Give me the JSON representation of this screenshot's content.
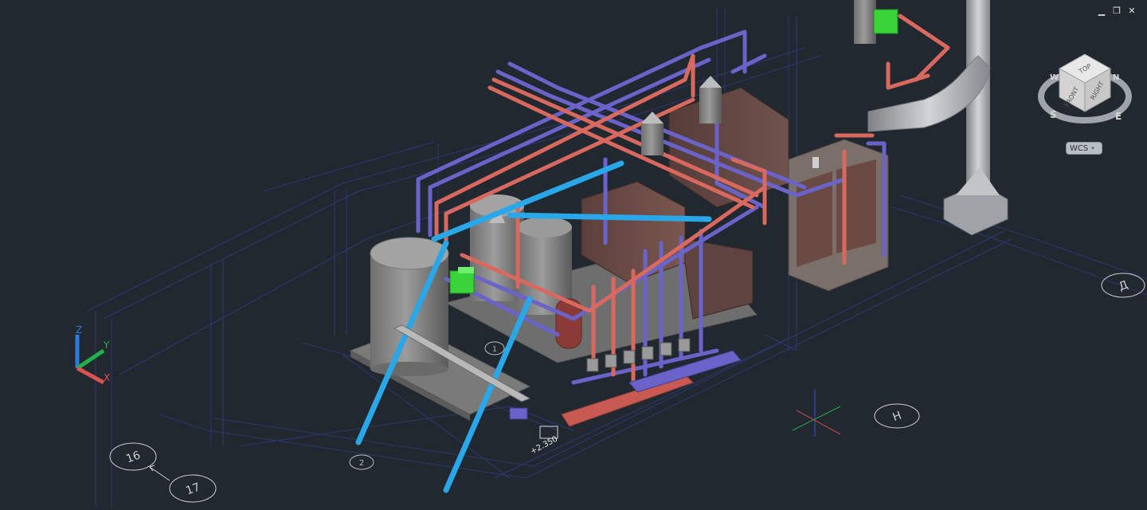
{
  "window_controls": {
    "minimize": "▁",
    "restore": "❐",
    "close": "✕"
  },
  "viewcube": {
    "top": "TOP",
    "front": "FRONT",
    "right": "RIGHT",
    "compass": {
      "n": "N",
      "s": "S",
      "e": "E",
      "w": "W"
    }
  },
  "wcs": {
    "label": "WCS",
    "caret": "▾"
  },
  "ucs": {
    "x": "X",
    "y": "Y",
    "z": "Z"
  },
  "grid_bubbles": [
    {
      "id": "16",
      "label": "16"
    },
    {
      "id": "17",
      "label": "17"
    },
    {
      "id": "2",
      "label": "2"
    },
    {
      "id": "1",
      "label": "1"
    },
    {
      "id": "H",
      "label": "H"
    },
    {
      "id": "D",
      "label": "Д"
    }
  ],
  "elevation_tag": "+2.350",
  "colors": {
    "background": "#212830",
    "pipe_red": "#d9695f",
    "pipe_blue": "#6a63c9",
    "support_cyan": "#2aa7e8",
    "equipment_gray": "#8e8e8e",
    "boiler_brown": "#6b4a44",
    "fan_green": "#3ad33a",
    "flue_silver": "#b9bcbf"
  }
}
